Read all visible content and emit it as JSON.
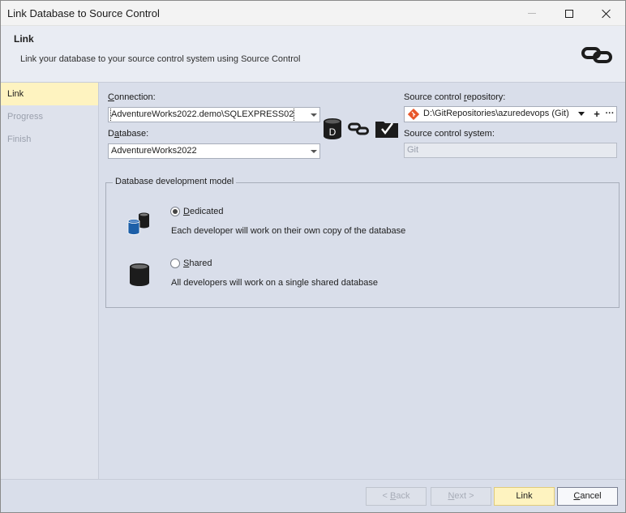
{
  "window": {
    "title": "Link Database to Source Control"
  },
  "header": {
    "title": "Link",
    "subtitle": "Link your database to your source control system using Source Control",
    "logo_icon": "chain-link-icon"
  },
  "sidebar": {
    "items": [
      {
        "label": "Link",
        "active": true
      },
      {
        "label": "Progress",
        "active": false
      },
      {
        "label": "Finish",
        "active": false
      }
    ]
  },
  "connection": {
    "label_pre": "",
    "label_ul": "C",
    "label_post": "onnection:",
    "value": "AdventureWorks2022.demo\\SQLEXPRESS02"
  },
  "database": {
    "label_pre": "D",
    "label_ul": "a",
    "label_post": "tabase:",
    "value": "AdventureWorks2022"
  },
  "link_graphic": {
    "icons": [
      "database-icon",
      "chain-link-icon",
      "source-control-icon"
    ],
    "database_letter": "D"
  },
  "repository": {
    "label_pre": "Source control ",
    "label_ul": "r",
    "label_post": "epository:",
    "value": "D:\\GitRepositories\\azuredevops (Git)",
    "add_glyph": "+",
    "more_glyph": "···"
  },
  "system": {
    "label": "Source control system:",
    "value": "Git"
  },
  "dev_model": {
    "title": "Database development model",
    "options": [
      {
        "label_ul": "D",
        "label_post": "edicated",
        "description": "Each developer will work on their own copy of the database",
        "checked": true
      },
      {
        "label_ul": "S",
        "label_post": "hared",
        "description": "All developers will work on a single shared database",
        "checked": false
      }
    ]
  },
  "footer": {
    "back_pre": "< ",
    "back_ul": "B",
    "back_post": "ack",
    "next_pre": "",
    "next_ul": "N",
    "next_post": "ext >",
    "link": "Link",
    "cancel_ul": "C",
    "cancel_post": "ancel"
  },
  "colors": {
    "active_item": "#fef3c0",
    "primary_button": "#fef3c0",
    "git_badge": "#e8562a",
    "database_blue": "#1d5fa8"
  }
}
